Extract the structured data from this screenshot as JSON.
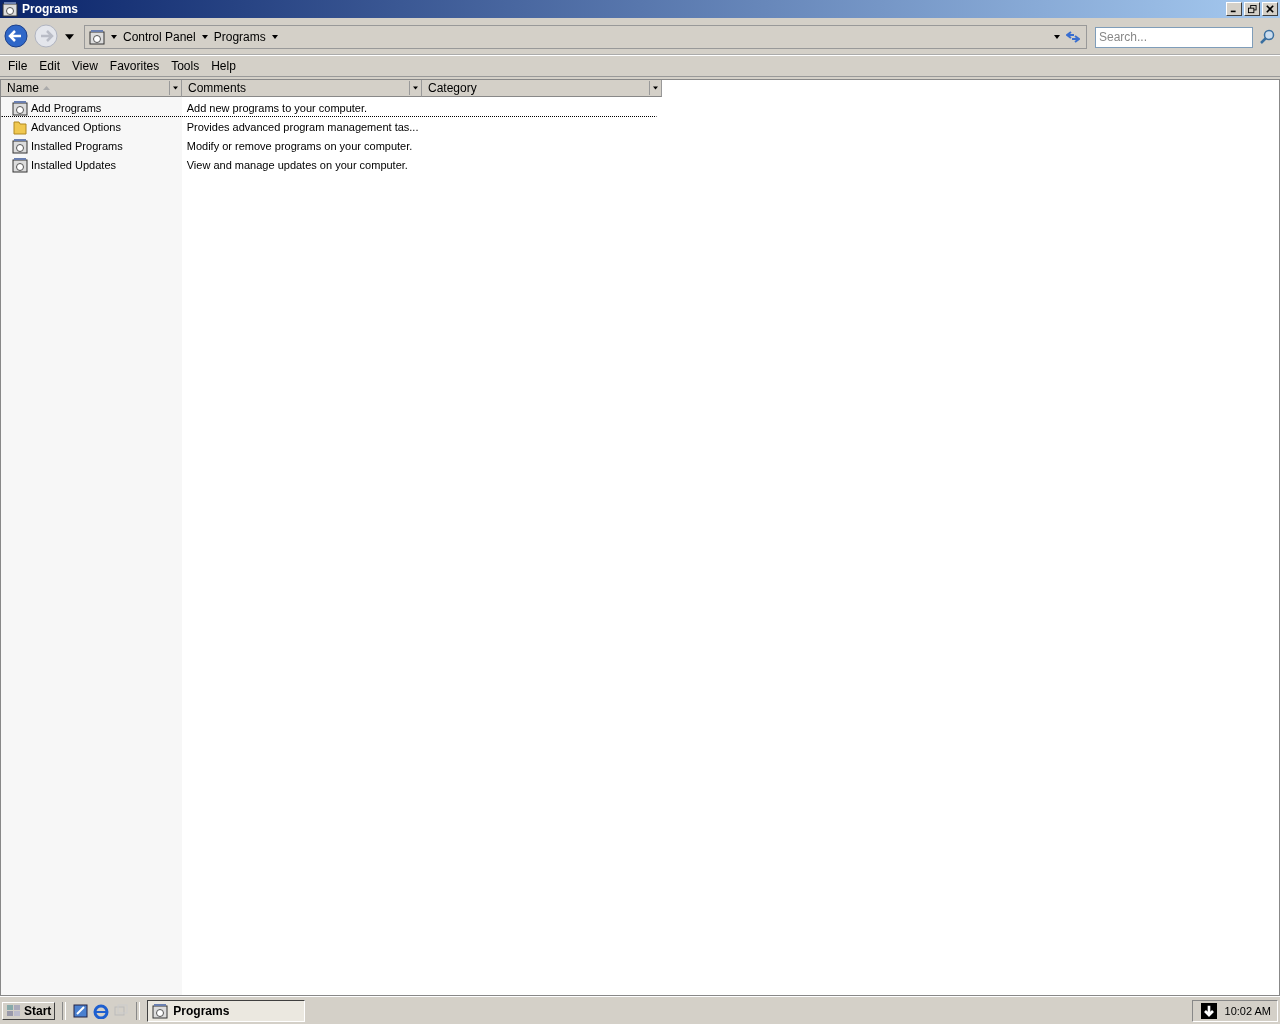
{
  "window": {
    "title": "Programs"
  },
  "address": {
    "crumbs": [
      "Control Panel",
      "Programs"
    ]
  },
  "search": {
    "placeholder": "Search..."
  },
  "menu": [
    "File",
    "Edit",
    "View",
    "Favorites",
    "Tools",
    "Help"
  ],
  "columns": [
    {
      "label": "Name",
      "sorted": true
    },
    {
      "label": "Comments",
      "sorted": false
    },
    {
      "label": "Category",
      "sorted": false
    }
  ],
  "rows": [
    {
      "name": "Add Programs",
      "comment": "Add new programs to your computer.",
      "kind": "applet",
      "focused": true
    },
    {
      "name": "Advanced Options",
      "comment": "Provides advanced program management tas...",
      "kind": "folder",
      "focused": false
    },
    {
      "name": "Installed Programs",
      "comment": "Modify or remove programs on your computer.",
      "kind": "applet",
      "focused": false
    },
    {
      "name": "Installed Updates",
      "comment": "View and manage updates on your computer.",
      "kind": "applet",
      "focused": false
    }
  ],
  "taskbar": {
    "start": "Start",
    "tasks": [
      {
        "label": "Programs",
        "selected": true
      }
    ],
    "clock": "10:02 AM"
  }
}
